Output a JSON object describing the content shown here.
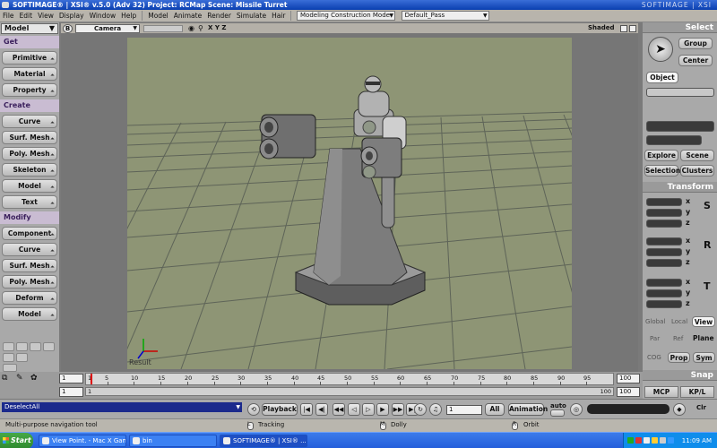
{
  "window": {
    "title": "SOFTIMAGE® | XSI® v.5.0 (Adv 32) Project: RCMap    Scene: Missile Turret",
    "brand": "SOFTIMAGE | XSI"
  },
  "menu": {
    "items": [
      "File",
      "Edit",
      "View",
      "Display",
      "Window",
      "Help"
    ],
    "modules": [
      "Model",
      "Animate",
      "Render",
      "Simulate",
      "Hair"
    ],
    "construction_mode": "Modeling Construction Mode",
    "pass": "Default_Pass"
  },
  "left_panel": {
    "mode": "Model",
    "get_header": "Get",
    "get_items": [
      "Primitive",
      "Material",
      "Property"
    ],
    "create_header": "Create",
    "create_items": [
      "Curve",
      "Surf. Mesh",
      "Poly. Mesh",
      "Skeleton",
      "Model",
      "Text"
    ],
    "modify_header": "Modify",
    "modify_items": [
      "Component",
      "Curve",
      "Surf. Mesh",
      "Poly. Mesh",
      "Deform",
      "Model"
    ]
  },
  "viewport": {
    "view_letter": "B",
    "camera": "Camera",
    "xyz": "X Y Z",
    "shading": "Shaded",
    "result_label": "Result"
  },
  "right_panel": {
    "select_header": "Select",
    "group": "Group",
    "center": "Center",
    "object": "Object",
    "explore": "Explore",
    "scene": "Scene",
    "selection": "Selection",
    "clusters": "Clusters",
    "transform_header": "Transform",
    "axes": [
      "x",
      "y",
      "z"
    ],
    "transform_icons": [
      "S",
      "R",
      "T"
    ],
    "global": "Global",
    "local": "Local",
    "view": "View",
    "par": "Par",
    "ref": "Ref",
    "plane": "Plane",
    "cog": "COG",
    "prop": "Prop",
    "sym": "Sym",
    "snap_header": "Snap",
    "mcp": "MCP",
    "kpl": "KP/L"
  },
  "timeline": {
    "start": "1",
    "end": "100",
    "current": "1",
    "range_start": "1",
    "range_end": "100",
    "range_end_right": "100",
    "ticks": [
      5,
      10,
      15,
      20,
      25,
      30,
      35,
      40,
      45,
      50,
      55,
      60,
      65,
      70,
      75,
      80,
      85,
      90,
      95
    ]
  },
  "playback": {
    "command": "DeselectAll",
    "playback": "Playback",
    "frame": "1",
    "all": "All",
    "animation": "Animation",
    "auto": "auto",
    "clr": "Clr"
  },
  "status": {
    "message": "Multi-purpose navigation tool",
    "left": "Tracking",
    "middle": "Dolly",
    "right": "Orbit",
    "l": "L",
    "m": "M",
    "r": "R"
  },
  "taskbar": {
    "start": "Start",
    "tasks": [
      "View Point. - Mac X Gam...",
      "bin",
      "SOFTIMAGE® | XSI® ..."
    ],
    "time": "11:09 AM"
  },
  "colors": {
    "scene_bg": "#8e9575",
    "grid_line": "#5e6458",
    "title_bar": "#0a3fb0",
    "panel": "#a9a9a9",
    "header_purple": "#c9bcd2",
    "model_gray": "#8a8a8a"
  }
}
